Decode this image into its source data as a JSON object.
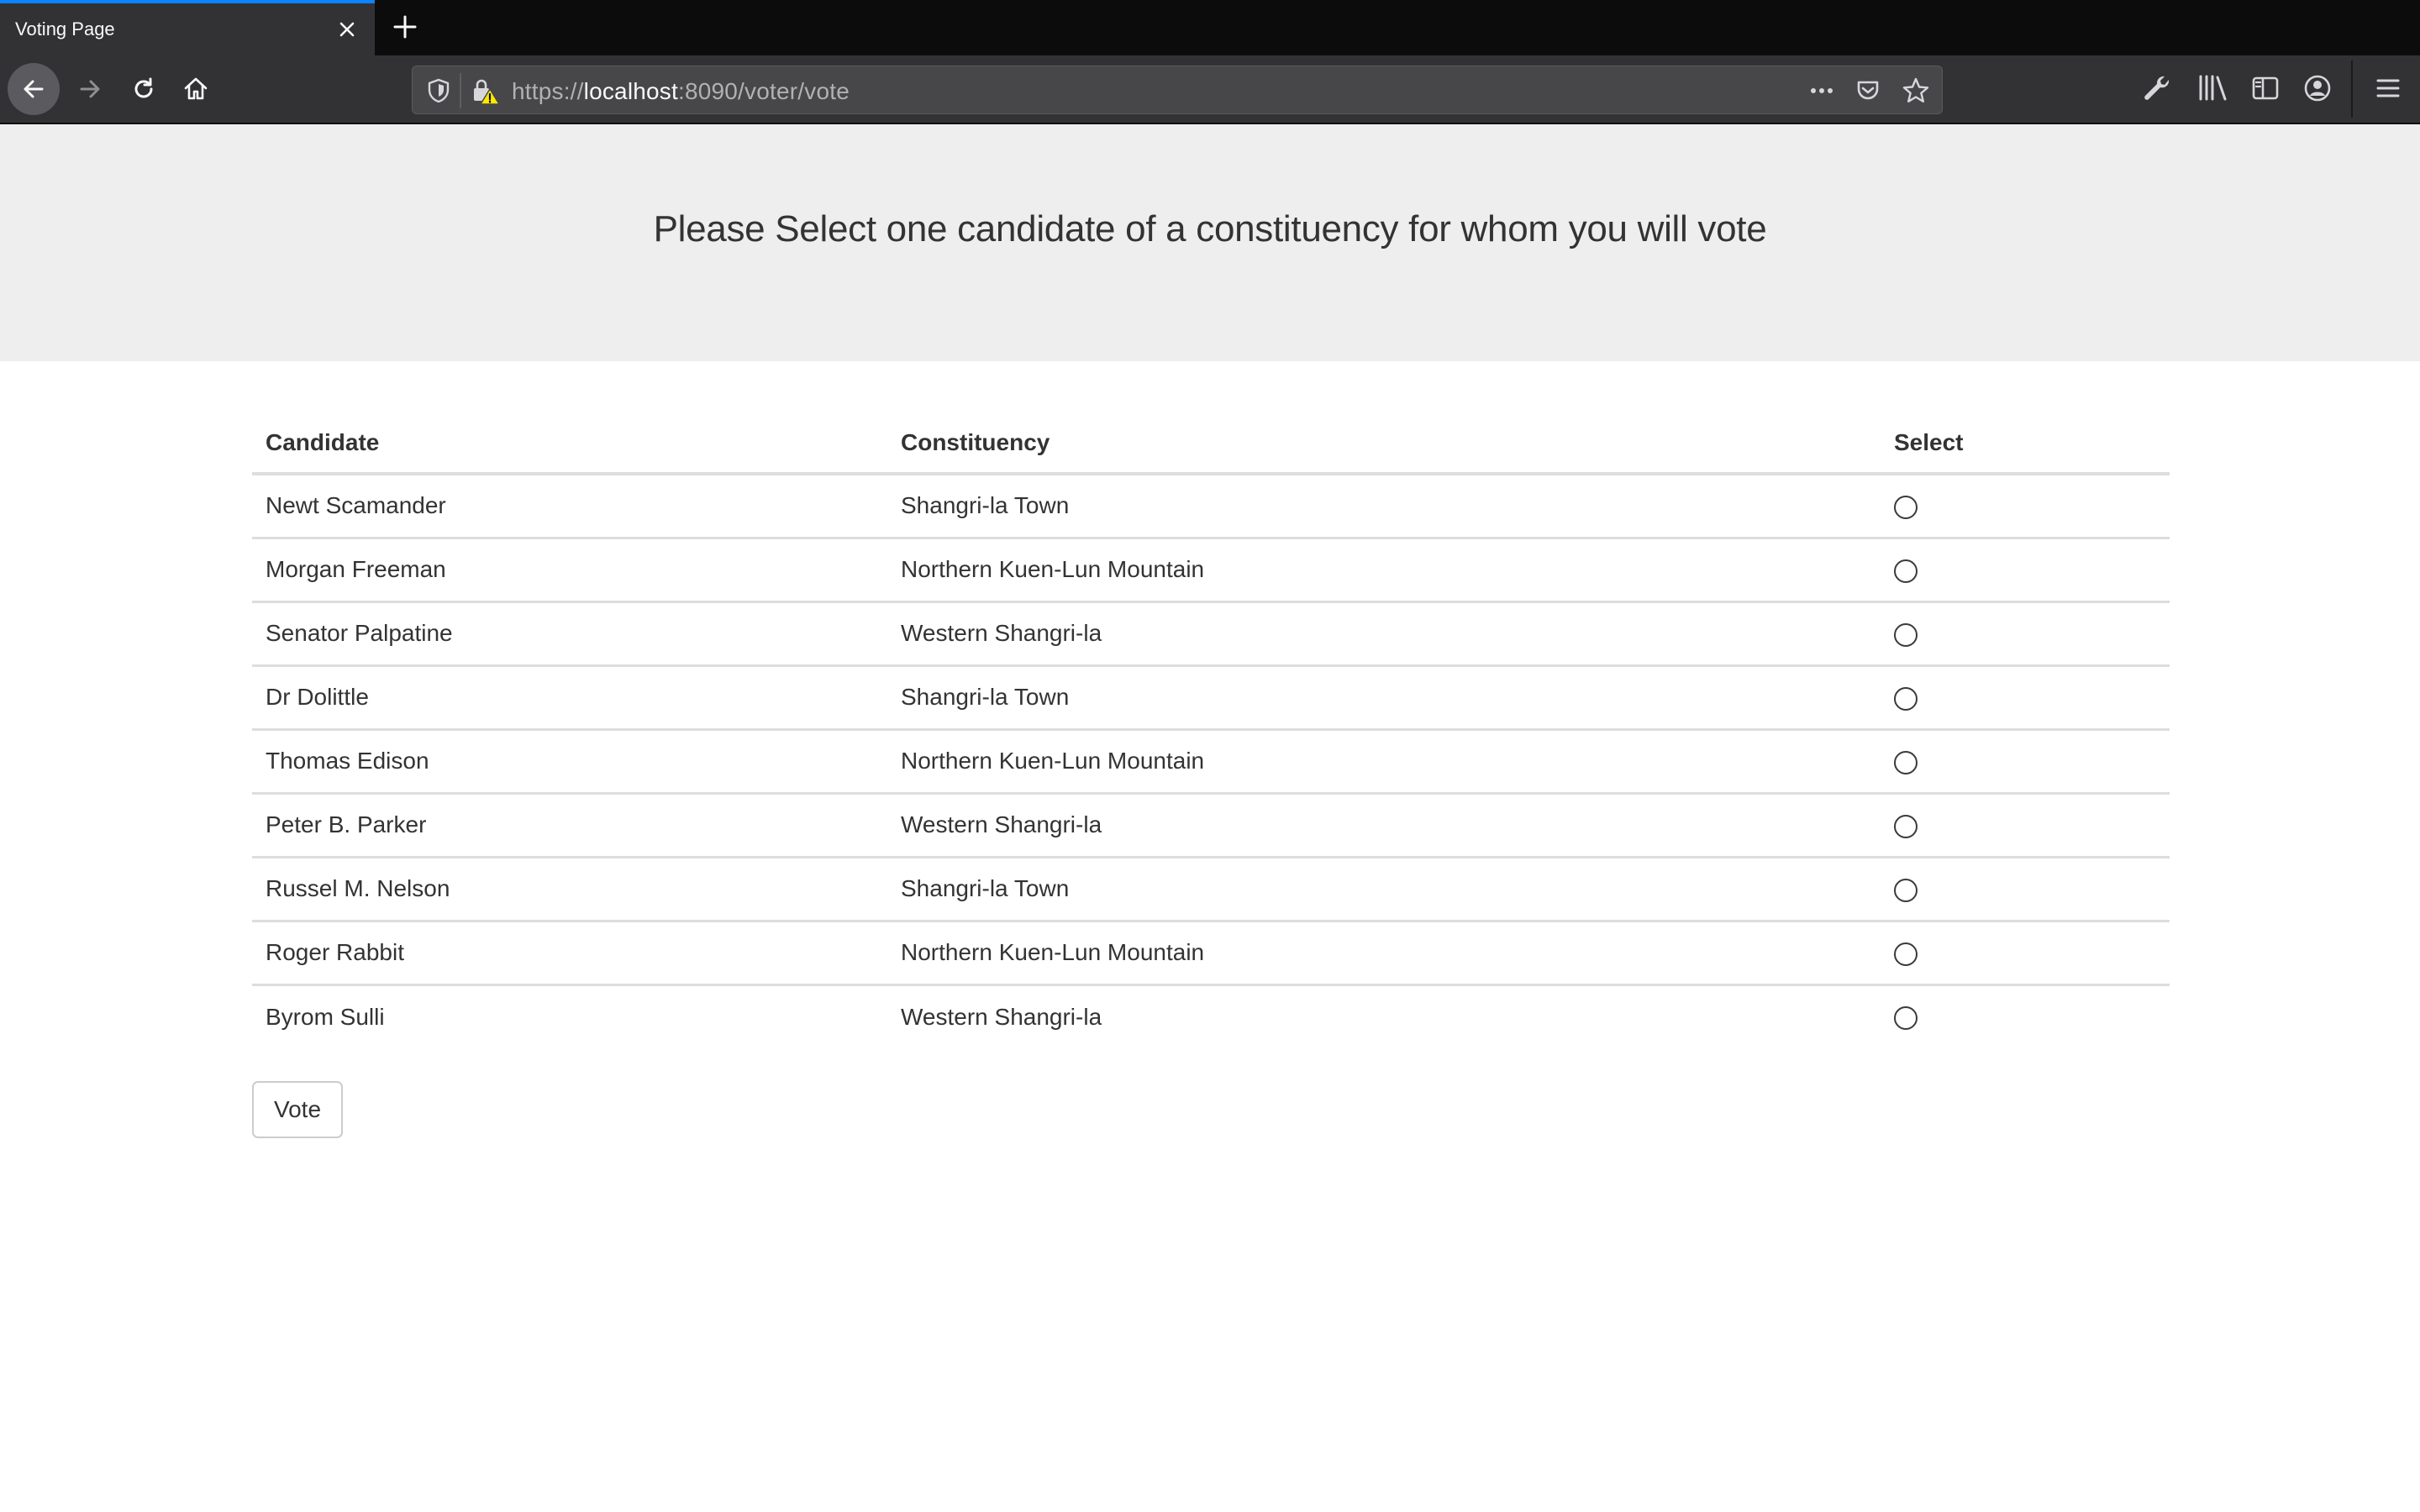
{
  "browser": {
    "tab_title": "Voting Page",
    "url": {
      "scheme": "https://",
      "host": "localhost",
      "rest": ":8090/voter/vote"
    },
    "accent_color": "#0a84ff"
  },
  "page": {
    "heading": "Please Select one candidate of a constituency for whom you will vote",
    "table": {
      "headers": {
        "candidate": "Candidate",
        "constituency": "Constituency",
        "select": "Select"
      },
      "rows": [
        {
          "candidate": "Newt Scamander",
          "constituency": "Shangri-la Town"
        },
        {
          "candidate": "Morgan Freeman",
          "constituency": "Northern Kuen-Lun Mountain"
        },
        {
          "candidate": "Senator Palpatine",
          "constituency": "Western Shangri-la"
        },
        {
          "candidate": "Dr Dolittle",
          "constituency": "Shangri-la Town"
        },
        {
          "candidate": "Thomas Edison",
          "constituency": "Northern Kuen-Lun Mountain"
        },
        {
          "candidate": "Peter B. Parker",
          "constituency": "Western Shangri-la"
        },
        {
          "candidate": "Russel M. Nelson",
          "constituency": "Shangri-la Town"
        },
        {
          "candidate": "Roger Rabbit",
          "constituency": "Northern Kuen-Lun Mountain"
        },
        {
          "candidate": "Byrom Sulli",
          "constituency": "Western Shangri-la"
        }
      ]
    },
    "vote_button": "Vote"
  }
}
